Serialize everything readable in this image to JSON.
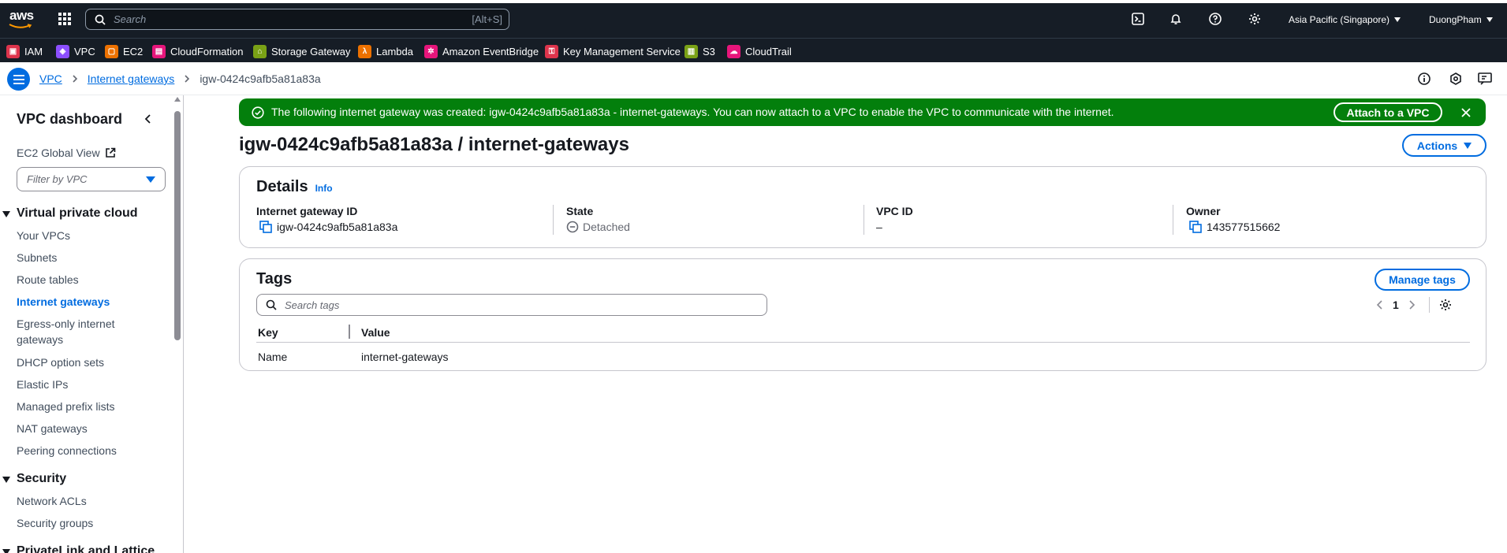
{
  "topnav": {
    "logo": "aws",
    "search_placeholder": "Search",
    "search_shortcut": "[Alt+S]",
    "region": "Asia Pacific (Singapore)",
    "user": "DuongPham"
  },
  "favorites": [
    {
      "label": "IAM",
      "color": "#dd344c"
    },
    {
      "label": "VPC",
      "color": "#8c4fff"
    },
    {
      "label": "EC2",
      "color": "#ed7100"
    },
    {
      "label": "CloudFormation",
      "color": "#e7157b"
    },
    {
      "label": "Storage Gateway",
      "color": "#7aa116"
    },
    {
      "label": "Lambda",
      "color": "#ed7100"
    },
    {
      "label": "Amazon EventBridge",
      "color": "#e7157b"
    },
    {
      "label": "Key Management Service",
      "color": "#dd344c"
    },
    {
      "label": "S3",
      "color": "#7aa116"
    },
    {
      "label": "CloudTrail",
      "color": "#e7157b"
    }
  ],
  "breadcrumb": {
    "items": [
      "VPC",
      "Internet gateways"
    ],
    "current": "igw-0424c9afb5a81a83a"
  },
  "sidebar": {
    "title": "VPC dashboard",
    "global_view": "EC2 Global View",
    "filter_placeholder": "Filter by VPC",
    "section1": "Virtual private cloud",
    "items1": [
      "Your VPCs",
      "Subnets",
      "Route tables",
      "Internet gateways",
      "Egress-only internet",
      "gateways",
      "DHCP option sets",
      "Elastic IPs",
      "Managed prefix lists",
      "NAT gateways",
      "Peering connections"
    ],
    "section2": "Security",
    "items2": [
      "Network ACLs",
      "Security groups"
    ],
    "section3": "PrivateLink and Lattice"
  },
  "flash": {
    "message": "The following internet gateway was created: igw-0424c9afb5a81a83a - internet-gateways. You can now attach to a VPC to enable the VPC to communicate with the internet.",
    "action": "Attach to a VPC",
    "color": "#037f0c"
  },
  "page": {
    "title": "igw-0424c9afb5a81a83a / internet-gateways",
    "actions": "Actions"
  },
  "details": {
    "heading": "Details",
    "info": "Info",
    "fields": [
      {
        "label": "Internet gateway ID",
        "value": "igw-0424c9afb5a81a83a"
      },
      {
        "label": "State",
        "value": "Detached"
      },
      {
        "label": "VPC ID",
        "value": "–"
      },
      {
        "label": "Owner",
        "value": "143577515662"
      }
    ]
  },
  "tags": {
    "heading": "Tags",
    "manage": "Manage tags",
    "search_placeholder": "Search tags",
    "page": "1",
    "columns": [
      "Key",
      "Value"
    ],
    "rows": [
      {
        "key": "Name",
        "value": "internet-gateways"
      }
    ]
  }
}
